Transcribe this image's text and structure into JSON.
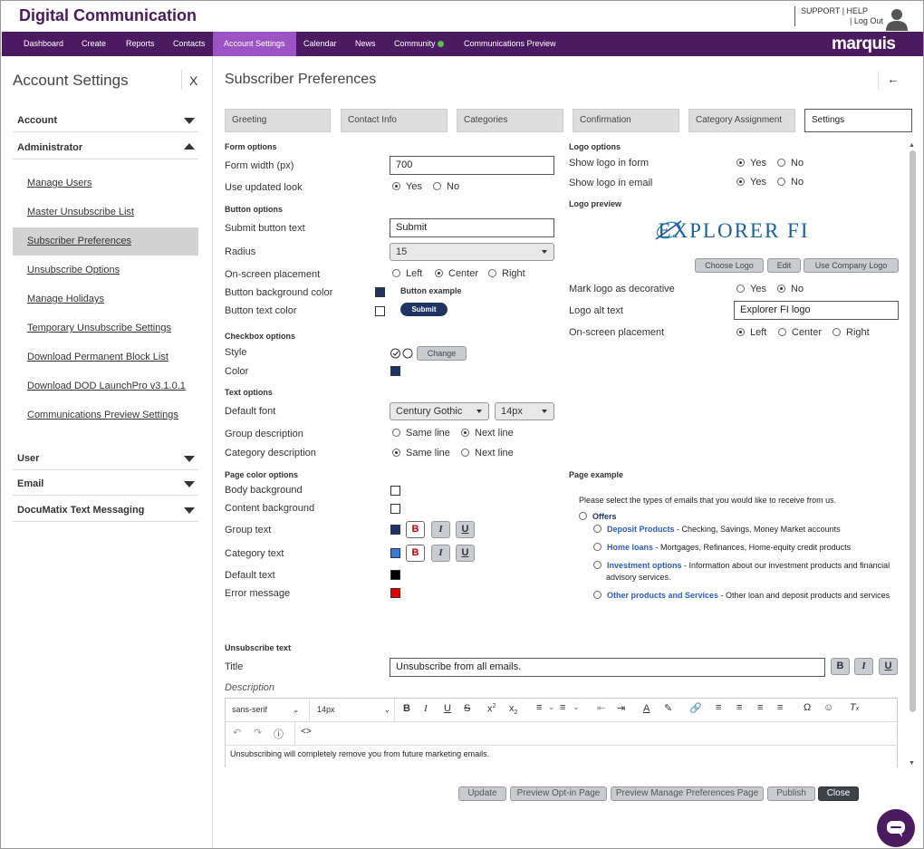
{
  "app": {
    "title": "Digital Communication",
    "support": "SUPPORT",
    "help": "HELP",
    "logout": "Log Out",
    "logo": "marquis"
  },
  "nav": [
    {
      "label": "Dashboard"
    },
    {
      "label": "Create"
    },
    {
      "label": "Reports"
    },
    {
      "label": "Contacts"
    },
    {
      "label": "Account Settings",
      "active": true
    },
    {
      "label": "Calendar"
    },
    {
      "label": "News"
    },
    {
      "label": "Community"
    },
    {
      "label": "Communications Preview"
    }
  ],
  "sidebar": {
    "title": "Account Settings",
    "close": "X",
    "sections": {
      "account": "Account",
      "administrator": "Administrator",
      "user": "User",
      "email": "Email",
      "documatix": "DocuMatix Text Messaging"
    },
    "items": [
      {
        "label": "Manage Users"
      },
      {
        "label": "Master Unsubscribe List"
      },
      {
        "label": "Subscriber Preferences",
        "active": true
      },
      {
        "label": "Unsubscribe Options"
      },
      {
        "label": "Manage Holidays"
      },
      {
        "label": "Temporary Unsubscribe Settings"
      },
      {
        "label": "Download Permanent Block List"
      },
      {
        "label": "Download DOD LaunchPro v3.1.0.1"
      },
      {
        "label": "Communications Preview Settings"
      }
    ]
  },
  "page": {
    "title": "Subscriber Preferences",
    "tabs": [
      "Greeting",
      "Contact Info",
      "Categories",
      "Confirmation",
      "Category Assignment",
      "Settings"
    ],
    "form_options": {
      "heading": "Form options",
      "width_label": "Form width (px)",
      "width_value": "700",
      "updated_label": "Use updated look",
      "yes": "Yes",
      "no": "No"
    },
    "button_options": {
      "heading": "Button options",
      "submit_text_label": "Submit button text",
      "submit_text_value": "Submit",
      "radius_label": "Radius",
      "radius_value": "15",
      "placement_label": "On-screen placement",
      "left": "Left",
      "center": "Center",
      "right": "Right",
      "bg_label": "Button background color",
      "text_label": "Button text color",
      "example_label": "Button example",
      "example_button": "Submit",
      "bg_color": "#1e3463",
      "text_color": "#ffffff"
    },
    "checkbox_options": {
      "heading": "Checkbox options",
      "style_label": "Style",
      "change": "Change",
      "color_label": "Color",
      "color": "#1e3463"
    },
    "text_options": {
      "heading": "Text options",
      "font_label": "Default font",
      "font_value": "Century Gothic",
      "size_value": "14px",
      "group_desc_label": "Group description",
      "cat_desc_label": "Category description",
      "same_line": "Same line",
      "next_line": "Next line"
    },
    "page_color_options": {
      "heading": "Page color options",
      "body_bg": "Body background",
      "content_bg": "Content background",
      "group_text": "Group text",
      "category_text": "Category text",
      "default_text": "Default text",
      "error_message": "Error message",
      "bold": "B",
      "italic": "I",
      "underline": "U",
      "colors": {
        "body": "#ffffff",
        "content": "#ffffff",
        "group": "#1e3463",
        "category": "#3a7bd5",
        "default": "#000000",
        "error": "#e00000"
      }
    },
    "logo_options": {
      "heading": "Logo options",
      "show_form": "Show logo in form",
      "show_email": "Show logo in email",
      "yes": "Yes",
      "no": "No",
      "preview_heading": "Logo preview",
      "logo_text": "EXPLORER FI",
      "choose": "Choose Logo",
      "edit": "Edit",
      "company": "Use Company Logo",
      "decorative_label": "Mark logo as decorative",
      "alt_label": "Logo alt text",
      "alt_value": "Explorer FI logo",
      "placement_label": "On-screen placement",
      "left": "Left",
      "center": "Center",
      "right": "Right"
    },
    "page_example": {
      "heading": "Page example",
      "intro": "Please select the types of emails that you would like to receive from us.",
      "group": "Offers",
      "items": [
        {
          "link": "Deposit Products",
          "desc": " - Checking, Savings, Money Market accounts"
        },
        {
          "link": "Home loans",
          "desc": " - Mortgages, Refinances, Home-equity credit products"
        },
        {
          "link": "Investment options",
          "desc": " - Information about our investment products and financial advisory services."
        },
        {
          "link": "Other products and Services",
          "desc": " - Other loan and deposit products and services"
        }
      ]
    },
    "unsubscribe": {
      "heading": "Unsubscribe text",
      "title_label": "Title",
      "title_value": "Unsubscribe from all emails.",
      "desc_label": "Description",
      "font": "sans-serif",
      "size": "14px",
      "body": "Unsubscribing will completely remove you from future marketing emails."
    },
    "footer": {
      "update": "Update",
      "preview_optin": "Preview Opt-in Page",
      "preview_manage": "Preview Manage Preferences Page",
      "publish": "Publish",
      "close": "Close"
    }
  }
}
